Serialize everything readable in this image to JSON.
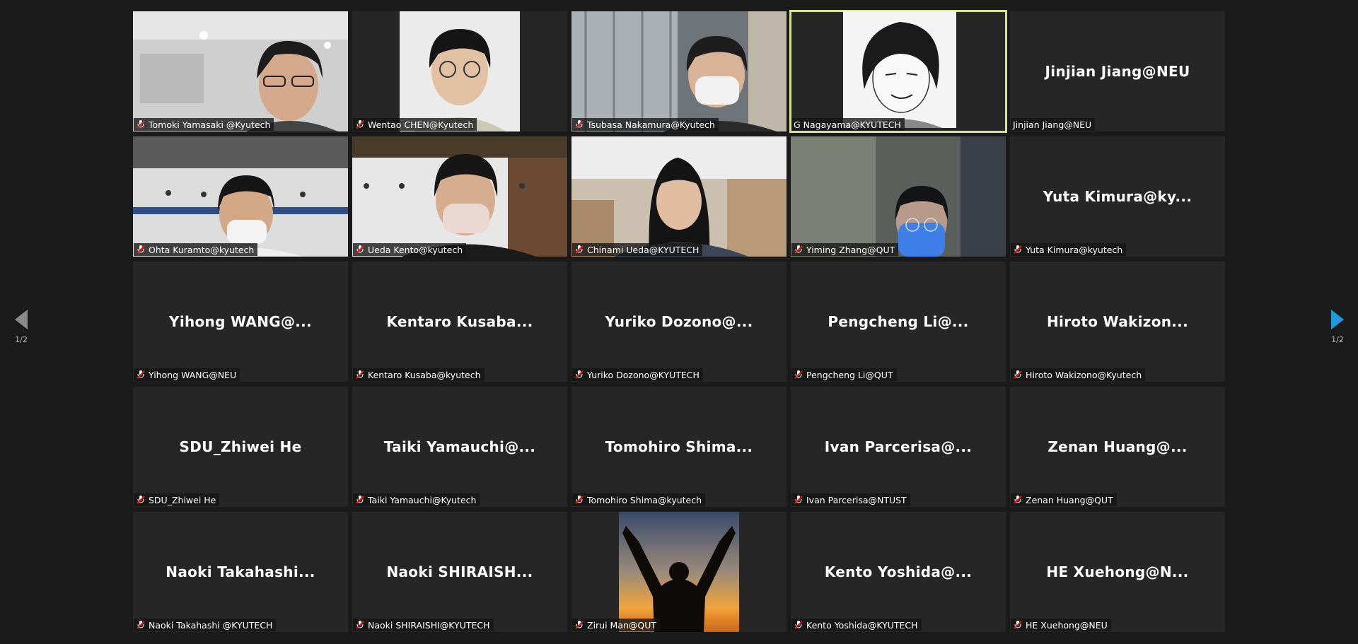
{
  "pagination": {
    "left_page": "1/2",
    "right_page": "1/2",
    "next_arrow_color": "#1a9bdc"
  },
  "tiles": [
    {
      "label": "Tomoki Yamasaki @Kyutech",
      "name": "",
      "video": true,
      "muted": true
    },
    {
      "label": "Wentao CHEN@Kyutech",
      "name": "",
      "video": true,
      "muted": true
    },
    {
      "label": "Tsubasa Nakamura@Kyutech",
      "name": "",
      "video": true,
      "muted": true
    },
    {
      "label": "G Nagayama@KYUTECH",
      "name": "",
      "video": true,
      "muted": false,
      "active": true
    },
    {
      "label": "Jinjian Jiang@NEU",
      "name": "Jinjian Jiang@NEU",
      "video": false,
      "muted": false
    },
    {
      "label": "Ohta Kuramto@kyutech",
      "name": "",
      "video": true,
      "muted": true
    },
    {
      "label": "Ueda Kento@kyutech",
      "name": "",
      "video": true,
      "muted": true
    },
    {
      "label": "Chinami Ueda@KYUTECH",
      "name": "",
      "video": true,
      "muted": true
    },
    {
      "label": "Yiming Zhang@QUT",
      "name": "",
      "video": true,
      "muted": true
    },
    {
      "label": "Yuta Kimura@kyutech",
      "name": "Yuta  Kimura@ky...",
      "video": false,
      "muted": true
    },
    {
      "label": "Yihong WANG@NEU",
      "name": "Yihong  WANG@...",
      "video": false,
      "muted": true
    },
    {
      "label": "Kentaro Kusaba@kyutech",
      "name": "Kentaro  Kusaba...",
      "video": false,
      "muted": true
    },
    {
      "label": "Yuriko Dozono@KYUTECH",
      "name": "Yuriko  Dozono@...",
      "video": false,
      "muted": true
    },
    {
      "label": "Pengcheng Li@QUT",
      "name": "Pengcheng  Li@...",
      "video": false,
      "muted": true
    },
    {
      "label": "Hiroto Wakizono@Kyutech",
      "name": "Hiroto  Wakizon...",
      "video": false,
      "muted": true
    },
    {
      "label": "SDU_Zhiwei He",
      "name": "SDU_Zhiwei He",
      "video": false,
      "muted": true
    },
    {
      "label": "Taiki Yamauchi@Kyutech",
      "name": "Taiki  Yamauchi@...",
      "video": false,
      "muted": true
    },
    {
      "label": "Tomohiro Shima@kyutech",
      "name": "Tomohiro  Shima...",
      "video": false,
      "muted": true
    },
    {
      "label": "Ivan Parcerisa@NTUST",
      "name": "Ivan  Parcerisa@...",
      "video": false,
      "muted": true
    },
    {
      "label": "Zenan Huang@QUT",
      "name": "Zenan  Huang@...",
      "video": false,
      "muted": true
    },
    {
      "label": "Naoki Takahashi @KYUTECH",
      "name": "Naoki  Takahashi...",
      "video": false,
      "muted": true
    },
    {
      "label": "Naoki SHIRAISHI@KYUTECH",
      "name": "Naoki  SHIRAISH...",
      "video": false,
      "muted": true
    },
    {
      "label": "Zirui Man@QUT",
      "name": "",
      "video": true,
      "muted": true
    },
    {
      "label": "Kento Yoshida@KYUTECH",
      "name": "Kento  Yoshida@...",
      "video": false,
      "muted": true
    },
    {
      "label": "HE Xuehong@NEU",
      "name": "HE  Xuehong@N...",
      "video": false,
      "muted": true
    }
  ]
}
